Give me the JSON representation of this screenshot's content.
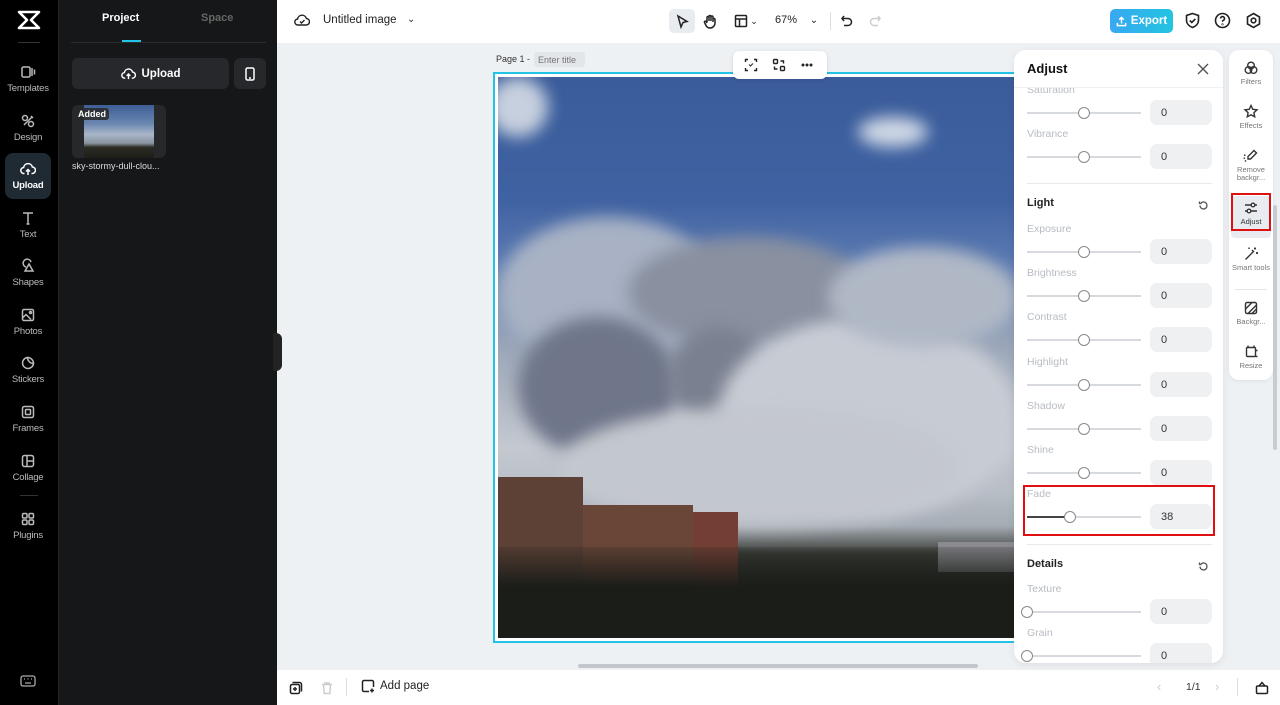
{
  "leftnav": {
    "logo": "capcut-logo",
    "items": [
      {
        "id": "templates",
        "label": "Templates",
        "icon": "templates-icon"
      },
      {
        "id": "design",
        "label": "Design",
        "icon": "design-icon"
      },
      {
        "id": "upload",
        "label": "Upload",
        "icon": "upload-cloud-icon",
        "active": true
      },
      {
        "id": "text",
        "label": "Text",
        "icon": "text-icon"
      },
      {
        "id": "shapes",
        "label": "Shapes",
        "icon": "shapes-icon"
      },
      {
        "id": "photos",
        "label": "Photos",
        "icon": "photos-icon"
      },
      {
        "id": "stickers",
        "label": "Stickers",
        "icon": "stickers-icon"
      },
      {
        "id": "frames",
        "label": "Frames",
        "icon": "frames-icon"
      },
      {
        "id": "collage",
        "label": "Collage",
        "icon": "collage-icon"
      },
      {
        "id": "plugins",
        "label": "Plugins",
        "icon": "plugins-icon"
      }
    ]
  },
  "panel": {
    "tabs": [
      {
        "label": "Project",
        "active": true
      },
      {
        "label": "Space",
        "active": false
      }
    ],
    "upload_label": "Upload",
    "assets": [
      {
        "badge": "Added",
        "name": "sky-stormy-dull-clou..."
      }
    ]
  },
  "topbar": {
    "doc_title": "Untitled image",
    "zoom": "67%",
    "export_label": "Export",
    "accent": "#22c3e6"
  },
  "canvas": {
    "page_label": "Page 1 -",
    "title_placeholder": "Enter title"
  },
  "bottombar": {
    "add_page_label": "Add page",
    "pager": "1/1"
  },
  "adjust": {
    "title": "Adjust",
    "rows_top": [
      {
        "label": "Saturation",
        "value": "0",
        "fraction": 0.5
      },
      {
        "label": "Vibrance",
        "value": "0",
        "fraction": 0.5
      }
    ],
    "light": {
      "title": "Light",
      "rows": [
        {
          "label": "Exposure",
          "value": "0",
          "fraction": 0.5
        },
        {
          "label": "Brightness",
          "value": "0",
          "fraction": 0.5
        },
        {
          "label": "Contrast",
          "value": "0",
          "fraction": 0.5
        },
        {
          "label": "Highlight",
          "value": "0",
          "fraction": 0.5
        },
        {
          "label": "Shadow",
          "value": "0",
          "fraction": 0.5
        },
        {
          "label": "Shine",
          "value": "0",
          "fraction": 0.5
        },
        {
          "label": "Fade",
          "value": "38",
          "fraction": 0.38
        }
      ]
    },
    "details": {
      "title": "Details",
      "rows": [
        {
          "label": "Texture",
          "value": "0",
          "fraction": 0
        },
        {
          "label": "Grain",
          "value": "0",
          "fraction": 0
        }
      ]
    },
    "highlight_color": "#e01010"
  },
  "siderail": {
    "items": [
      {
        "label": "Filters",
        "icon": "filters-icon"
      },
      {
        "label": "Effects",
        "icon": "effects-icon"
      },
      {
        "label": "Remove backgr...",
        "icon": "remove-background-icon"
      },
      {
        "label": "Adjust",
        "icon": "adjust-sliders-icon",
        "active": true
      },
      {
        "label": "Smart tools",
        "icon": "smart-tools-icon"
      },
      {
        "label": "Backgr...",
        "icon": "background-icon"
      },
      {
        "label": "Resize",
        "icon": "resize-icon"
      }
    ]
  }
}
